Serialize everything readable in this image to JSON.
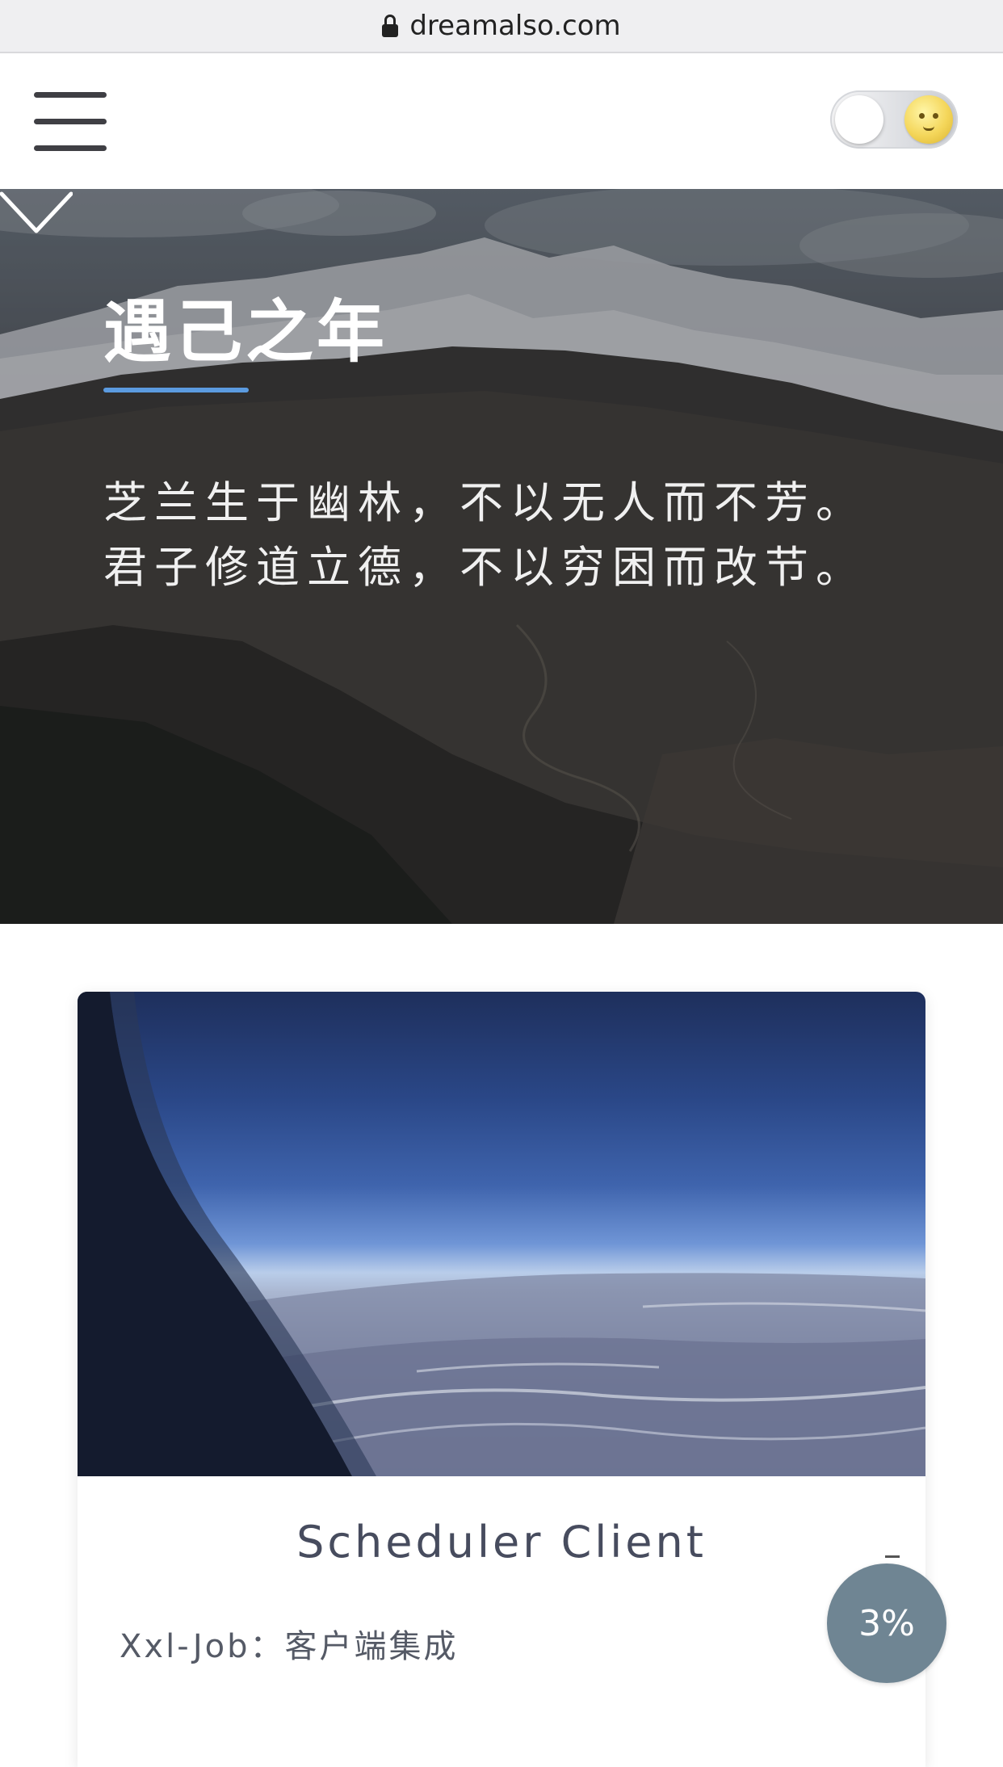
{
  "browser": {
    "url": "dreamalso.com",
    "lock_icon": "lock-icon"
  },
  "header": {
    "menu_icon": "hamburger-menu-icon",
    "theme_toggle": {
      "state": "light",
      "icon": "moon-face-icon"
    }
  },
  "hero": {
    "title": "遇己之年",
    "accent_color": "#5b9be0",
    "lines": [
      "芝兰生于幽林，不以无人而不芳。",
      "君子修道立德，不以穷困而改节。"
    ],
    "scroll_icon": "chevron-down-icon"
  },
  "post": {
    "title": "Scheduler Client",
    "subtitle": "Xxl-Job：客户端集成"
  },
  "reading_progress": {
    "label": "3%",
    "value": 3,
    "color": "#6f8593"
  }
}
